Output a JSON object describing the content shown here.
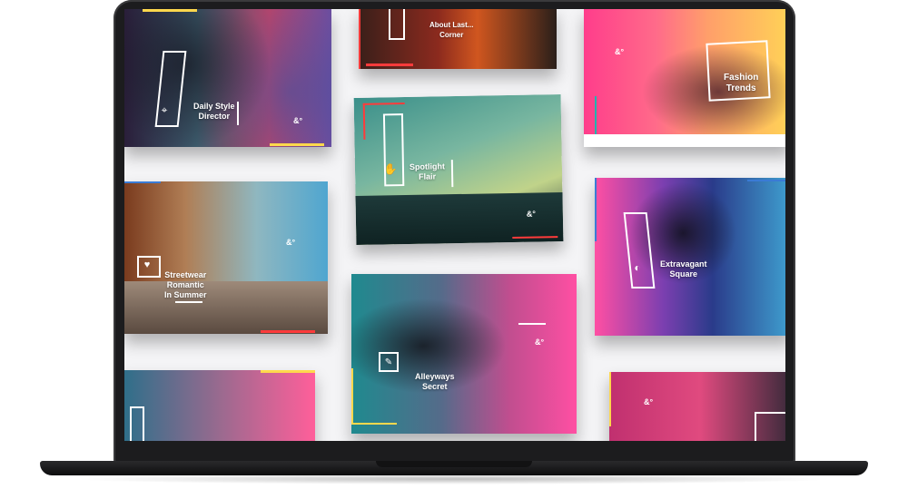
{
  "slides": [
    {
      "caption": "Daily Style\nDirector"
    },
    {
      "caption": "About Last...\nCorner"
    },
    {
      "caption": "Fashion\nTrends"
    },
    {
      "caption": "Spotlight\nFlair"
    },
    {
      "caption": "Streetwear\nRomantic\nIn Summer"
    },
    {
      "caption": "Extravagant\nSquare"
    },
    {
      "caption": "Alleyways\nSecret"
    }
  ],
  "brand_mark": "&°",
  "colors": {
    "pink": "#ff4fa3",
    "yellow": "#ffd84d",
    "teal": "#1fb5b0",
    "blue": "#3a7bd5",
    "purple": "#7b3fb0"
  },
  "icons": [
    "map-pin-icon",
    "hand-icon",
    "heart-icon",
    "moon-icon",
    "pencil-icon"
  ]
}
